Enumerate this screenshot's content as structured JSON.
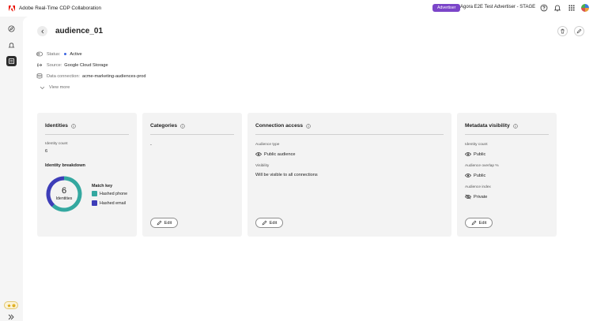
{
  "app": {
    "title": "Adobe Real-Time CDP Collaboration",
    "logo_color": "#eb1000"
  },
  "topbar": {
    "badge": "Advertiser",
    "badge_color": "#7b45c9",
    "account": "Agora E2E Test Advertiser - STAGE",
    "icons": [
      "help-icon",
      "bell-icon",
      "apps-grid-icon",
      "avatar"
    ]
  },
  "rail": {
    "items": [
      "discover-icon",
      "connections-icon",
      "audiences-icon"
    ],
    "active": "audiences-icon"
  },
  "page": {
    "title": "audience_01"
  },
  "meta": {
    "status_label": "Status:",
    "status_value": "Active",
    "source_label": "Source:",
    "source_value": "Google Cloud Storage",
    "connection_label": "Data connection:",
    "connection_value": "acme-marketing-audiences-prod",
    "view_more": "View more"
  },
  "cards": {
    "identities": {
      "title": "Identities",
      "count_label": "Identity count",
      "count_value": "6",
      "breakdown_title": "Identity breakdown",
      "donut_number": "6",
      "donut_label": "Identities",
      "legend_title": "Match key",
      "legend": [
        {
          "label": "Hashed phone",
          "color": "#34a8a0"
        },
        {
          "label": "Hashed email",
          "color": "#3d3db8"
        }
      ]
    },
    "categories": {
      "title": "Categories",
      "value": "-",
      "edit": "Edit"
    },
    "connection_access": {
      "title": "Connection access",
      "type_label": "Audience type",
      "type_value": "Public audience",
      "visibility_label": "Visibility",
      "visibility_value": "Will be visible to all connections",
      "edit": "Edit"
    },
    "metadata_visibility": {
      "title": "Metadata visibility",
      "items": [
        {
          "label": "Identity count",
          "value": "Public",
          "icon": "eye-icon"
        },
        {
          "label": "Audience overlap %",
          "value": "Public",
          "icon": "eye-icon"
        },
        {
          "label": "Audience index",
          "value": "Private",
          "icon": "eye-off-icon"
        }
      ],
      "edit": "Edit"
    }
  }
}
